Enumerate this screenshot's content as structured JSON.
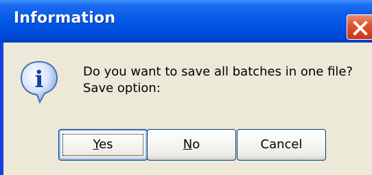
{
  "window": {
    "title": "Information"
  },
  "icons": {
    "title_close": "close-icon",
    "message": "information-icon",
    "message_glyph": "i"
  },
  "message": {
    "line1": "Do you want to save all batches in one file?",
    "line2": "Save option:"
  },
  "buttons": {
    "yes": {
      "mnemonic": "Y",
      "rest": "es"
    },
    "no": {
      "mnemonic": "N",
      "rest": "o"
    },
    "cancel": {
      "label": "Cancel"
    }
  },
  "colors": {
    "titlebar": "#0054e3",
    "close_button": "#e0542f",
    "dialog_background": "#ece9d8",
    "button_border": "#003c74"
  }
}
